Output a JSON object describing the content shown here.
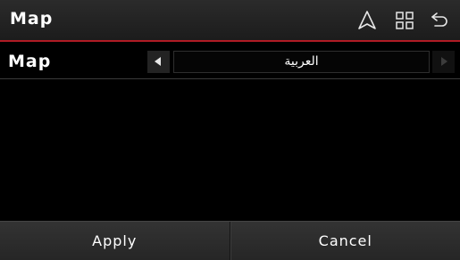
{
  "header": {
    "title": "Map",
    "icons": [
      "navigation-arrow-icon",
      "grid-menu-icon",
      "back-icon"
    ]
  },
  "setting": {
    "label": "Map",
    "value": "العربية"
  },
  "footer": {
    "apply_label": "Apply",
    "cancel_label": "Cancel"
  },
  "colors": {
    "accent": "#b01c25",
    "background": "#000000",
    "text": "#ffffff"
  }
}
